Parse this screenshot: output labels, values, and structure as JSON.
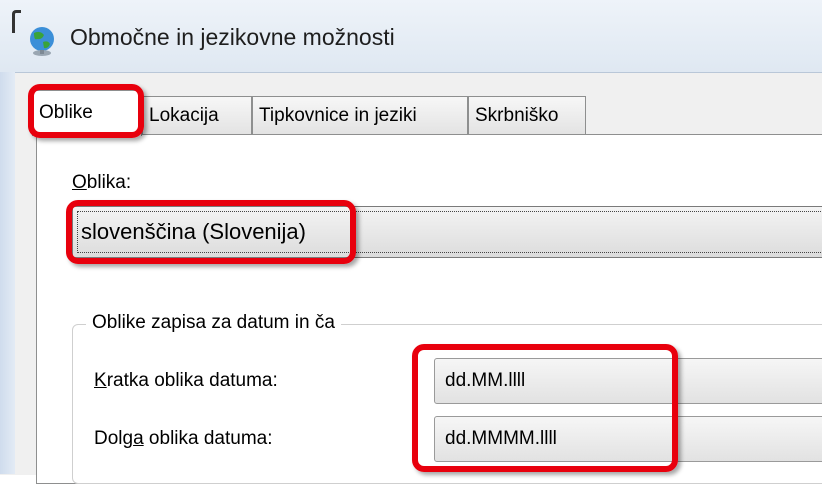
{
  "window": {
    "title": "Območne in jezikovne možnosti",
    "icon": "globe-icon"
  },
  "tabs": [
    {
      "label": "Oblike",
      "active": true
    },
    {
      "label": "Lokacija",
      "active": false
    },
    {
      "label": "Tipkovnice in jeziki",
      "active": false
    },
    {
      "label": "Skrbniško",
      "active": false
    }
  ],
  "format": {
    "label_first": "O",
    "label_rest": "blika:",
    "selected_value": "slovenščina (Slovenija)"
  },
  "date_time_group": {
    "title": "Oblike zapisa za datum in ča",
    "short_date": {
      "label_first": "K",
      "label_rest": "ratka oblika datuma:",
      "value": "dd.MM.llll"
    },
    "long_date": {
      "label_start": "Dolg",
      "label_underlined": "a",
      "label_end": " oblika datuma:",
      "value": "dd.MMMM.llll"
    }
  },
  "highlight_color": "#e8000d"
}
